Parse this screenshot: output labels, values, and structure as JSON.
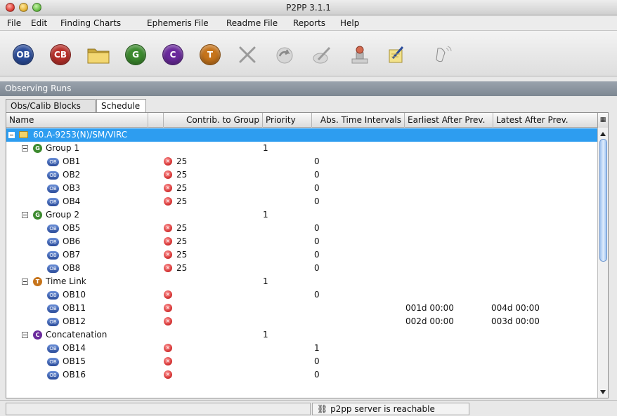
{
  "window": {
    "title": "P2PP 3.1.1"
  },
  "menu": [
    {
      "label": "File"
    },
    {
      "label": "Edit"
    },
    {
      "label": "Finding Charts"
    },
    {
      "label": "Ephemeris File"
    },
    {
      "label": "Readme File"
    },
    {
      "label": "Reports"
    },
    {
      "label": "Help"
    }
  ],
  "toolbar": {
    "ob_label": "OB",
    "cb_label": "CB",
    "g_label": "G",
    "c_label": "C",
    "t_label": "T"
  },
  "panel": {
    "title": "Observing Runs"
  },
  "tabs": [
    {
      "label": "Obs/Calib Blocks"
    },
    {
      "label": "Schedule"
    }
  ],
  "columns": {
    "name": "Name",
    "contrib": "Contrib. to Group",
    "priority": "Priority",
    "abs_time": "Abs. Time Intervals",
    "earliest": "Earliest After Prev.",
    "latest": "Latest After Prev."
  },
  "run": {
    "label": "60.A-9253(N)/SM/VIRC"
  },
  "rows": [
    {
      "kind": "group",
      "icon": "G",
      "label": "Group 1",
      "priority": "1"
    },
    {
      "kind": "ob",
      "label": "OB1",
      "contrib": "25",
      "abs": "0"
    },
    {
      "kind": "ob",
      "label": "OB2",
      "contrib": "25",
      "abs": "0"
    },
    {
      "kind": "ob",
      "label": "OB3",
      "contrib": "25",
      "abs": "0"
    },
    {
      "kind": "ob",
      "label": "OB4",
      "contrib": "25",
      "abs": "0"
    },
    {
      "kind": "group",
      "icon": "G",
      "label": "Group 2",
      "priority": "1"
    },
    {
      "kind": "ob",
      "label": "OB5",
      "contrib": "25",
      "abs": "0"
    },
    {
      "kind": "ob",
      "label": "OB6",
      "contrib": "25",
      "abs": "0"
    },
    {
      "kind": "ob",
      "label": "OB7",
      "contrib": "25",
      "abs": "0"
    },
    {
      "kind": "ob",
      "label": "OB8",
      "contrib": "25",
      "abs": "0"
    },
    {
      "kind": "group",
      "icon": "T",
      "label": "Time Link",
      "priority": "1"
    },
    {
      "kind": "ob",
      "label": "OB10",
      "contrib": "",
      "abs": "0"
    },
    {
      "kind": "ob",
      "label": "OB11",
      "contrib": "",
      "abs": "",
      "earliest": "001d 00:00",
      "latest": "004d 00:00"
    },
    {
      "kind": "ob",
      "label": "OB12",
      "contrib": "",
      "abs": "",
      "earliest": "002d 00:00",
      "latest": "003d 00:00"
    },
    {
      "kind": "group",
      "icon": "C",
      "label": "Concatenation",
      "priority": "1"
    },
    {
      "kind": "ob",
      "label": "OB14",
      "contrib": "",
      "abs": "1"
    },
    {
      "kind": "ob",
      "label": "OB15",
      "contrib": "",
      "abs": "0"
    },
    {
      "kind": "ob",
      "label": "OB16",
      "contrib": "",
      "abs": "0"
    }
  ],
  "status": {
    "message": "p2pp server is reachable"
  },
  "colors": {
    "selection": "#2d9df0",
    "group_g": "#3c8a2e",
    "group_t": "#c6741b",
    "group_c": "#6a2a9c",
    "ob": "#2b4c9a",
    "cb": "#b8302a",
    "error": "#d93a3a"
  }
}
